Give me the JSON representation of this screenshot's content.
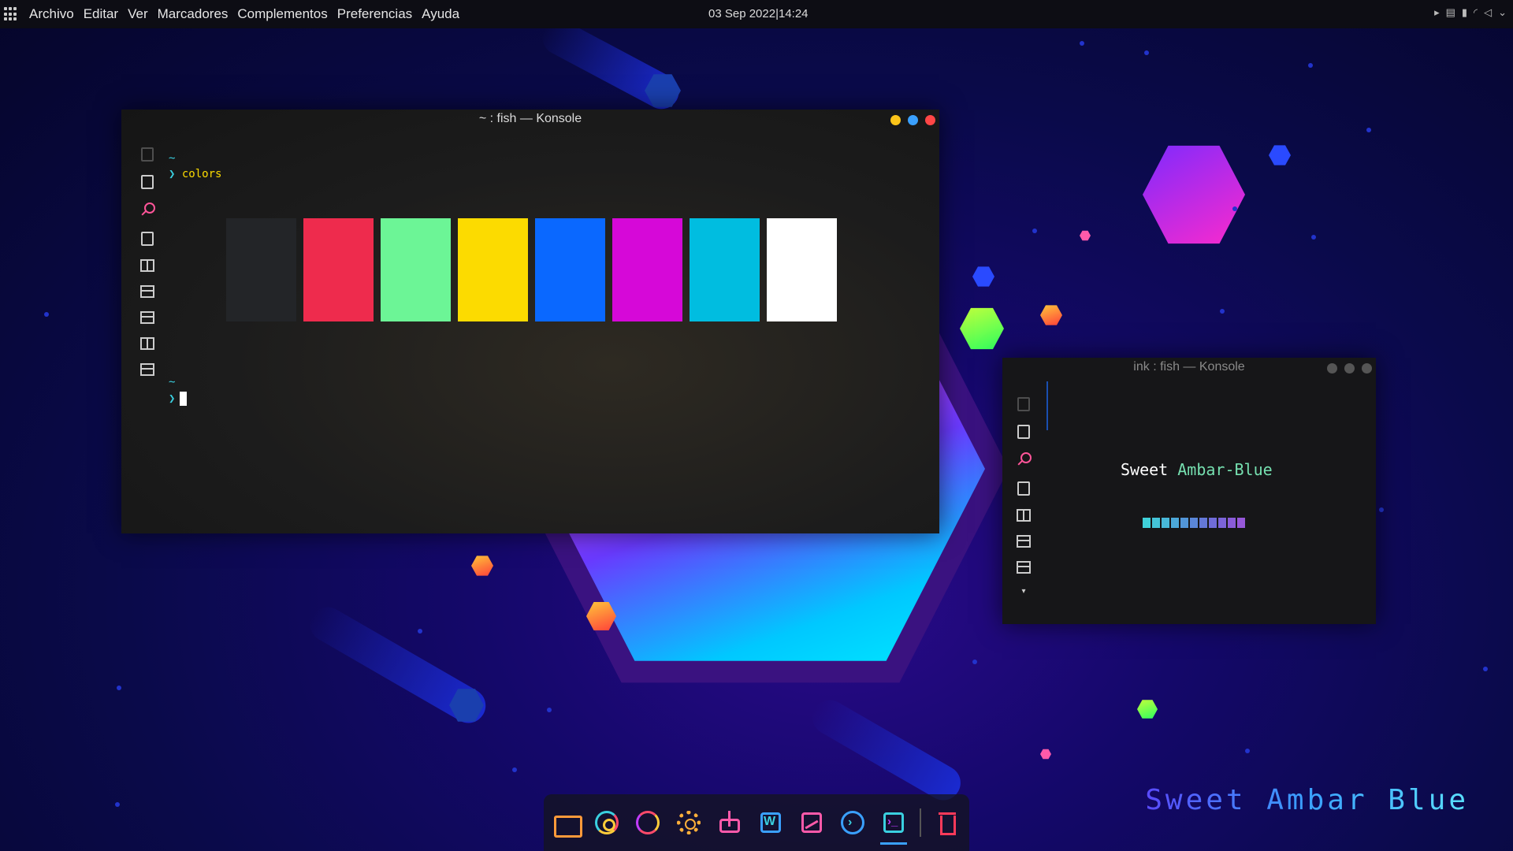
{
  "topbar": {
    "menu": [
      "Archivo",
      "Editar",
      "Ver",
      "Marcadores",
      "Complementos",
      "Preferencias",
      "Ayuda"
    ],
    "clock": "03 Sep 2022|14:24",
    "tray_icons": [
      "play-icon",
      "clipboard-icon",
      "battery-icon",
      "network-icon",
      "volume-icon",
      "chevron-down-icon"
    ]
  },
  "main_window": {
    "title": "~ : fish — Konsole",
    "prompt_dir_1": "~",
    "prompt_symbol_1": "❯",
    "command_1": "colors",
    "prompt_dir_2": "~",
    "prompt_symbol_2": "❯",
    "swatch_colors": [
      "#232528",
      "#ee2b4d",
      "#6cf596",
      "#fcdb00",
      "#0a68ff",
      "#d608d8",
      "#00bde0",
      "#ffffff"
    ],
    "controls": {
      "minimize": "#fcc419",
      "maximize": "#3aa0ff",
      "close": "#ff4646"
    }
  },
  "small_window": {
    "title": "ink : fish — Konsole",
    "banner_part1": "Sweet",
    "banner_part2": "Ambar-Blue",
    "bar_colors": [
      "#3fd0d8",
      "#44c4d8",
      "#48b8d8",
      "#4ca8d8",
      "#5296d8",
      "#5a86d8",
      "#6478d8",
      "#706cd8",
      "#7c64d8",
      "#8a5cd8",
      "#9658d8"
    ]
  },
  "dock": {
    "items": [
      "folder-icon",
      "chrome-icon",
      "audio-player-icon",
      "settings-icon",
      "download-icon",
      "writer-icon",
      "image-viewer-icon",
      "vscode-icon",
      "terminal-icon",
      "trash-icon"
    ]
  },
  "watermark": "Sweet Ambar Blue"
}
